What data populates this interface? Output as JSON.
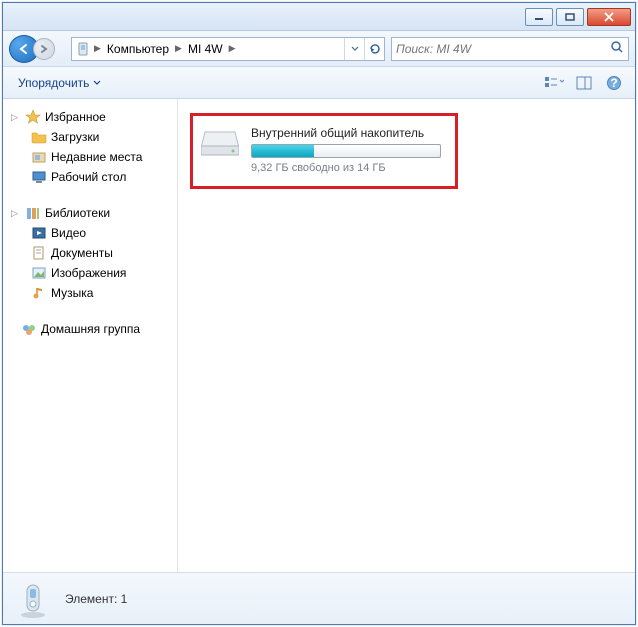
{
  "titlebar": {},
  "breadcrumbs": {
    "root": "Компьютер",
    "device": "MI 4W"
  },
  "search": {
    "placeholder": "Поиск: MI 4W"
  },
  "toolbar": {
    "organize_label": "Упорядочить"
  },
  "sidebar": {
    "favorites": {
      "header": "Избранное",
      "items": [
        "Загрузки",
        "Недавние места",
        "Рабочий стол"
      ]
    },
    "libraries": {
      "header": "Библиотеки",
      "items": [
        "Видео",
        "Документы",
        "Изображения",
        "Музыка"
      ]
    },
    "homegroup": {
      "header": "Домашняя группа"
    }
  },
  "content": {
    "drive": {
      "title": "Внутренний общий накопитель",
      "status": "9,32 ГБ свободно из 14 ГБ",
      "used_percent": 33
    }
  },
  "statusbar": {
    "label": "Элемент: 1"
  }
}
